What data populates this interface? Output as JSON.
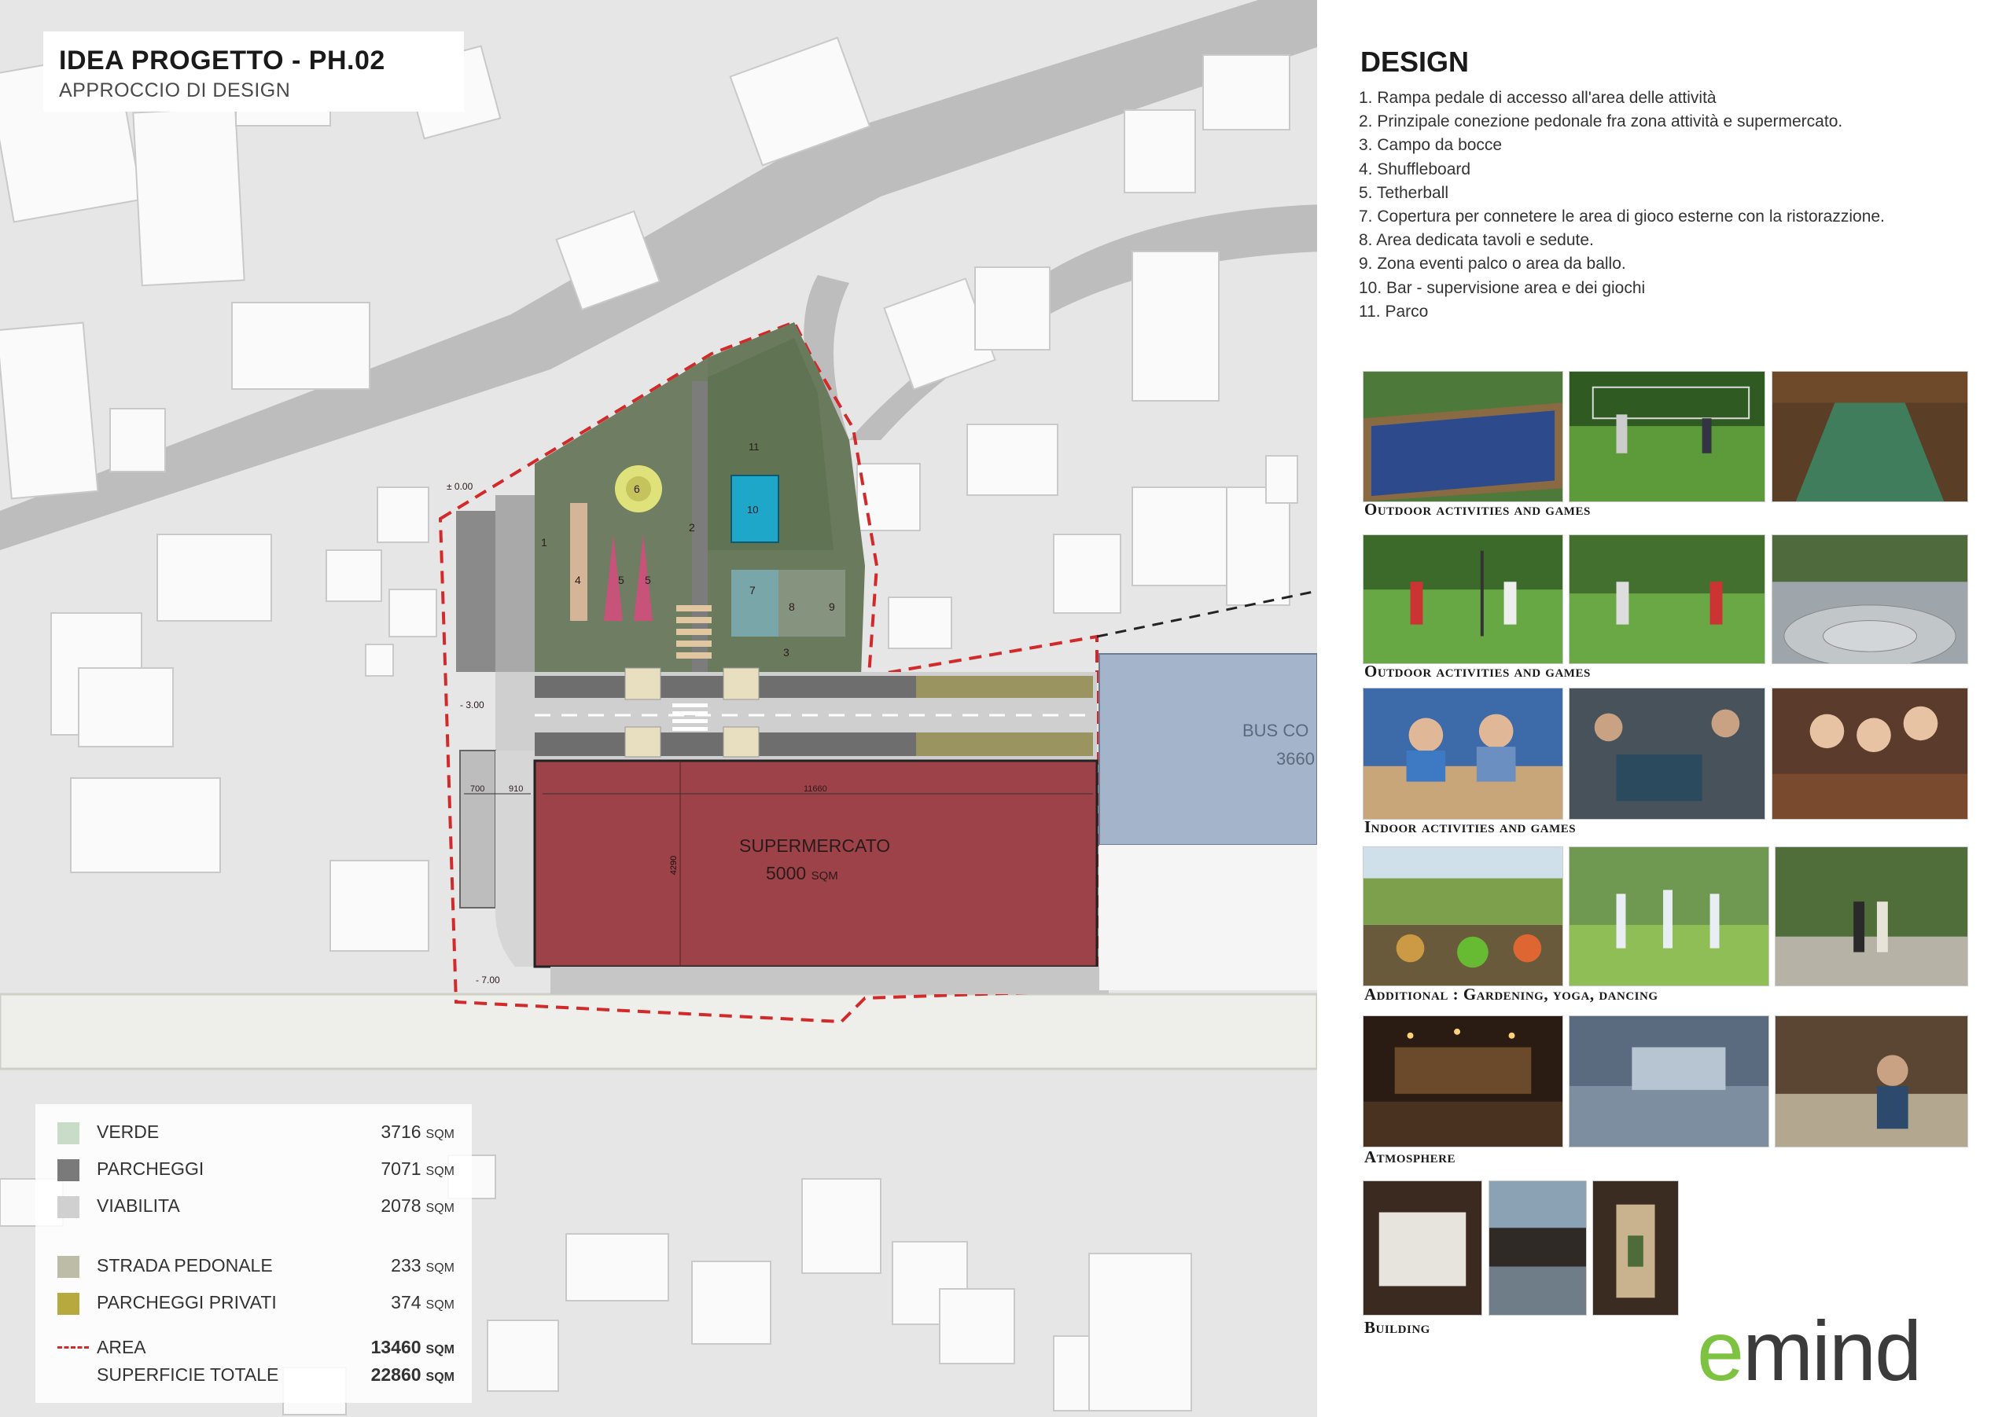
{
  "header": {
    "title": "IDEA PROGETTO - PH.02",
    "subtitle": "APPROCCIO DI DESIGN"
  },
  "plan": {
    "supermarket_label": "SUPERMERCATO",
    "supermarket_area": "5000",
    "supermarket_unit": "SQM",
    "bus_label": "BUS CO",
    "bus_value": "3660",
    "dim_11660": "11660",
    "dim_700": "700",
    "dim_910": "910",
    "dim_4290": "4290",
    "level_000": "± 0.00",
    "level_300": "- 3.00",
    "level_700": "- 7.00",
    "numbers": [
      "1",
      "2",
      "3",
      "4",
      "5",
      "5",
      "6",
      "7",
      "8",
      "9",
      "10",
      "11"
    ]
  },
  "legend": {
    "items": [
      {
        "label": "VERDE",
        "value": "3716",
        "unit": "SQM",
        "color": "#c9dcc7"
      },
      {
        "label": "PARCHEGGI",
        "value": "7071",
        "unit": "SQM",
        "color": "#7a7a7a"
      },
      {
        "label": "VIABILITA",
        "value": "2078",
        "unit": "SQM",
        "color": "#d0d0d0"
      },
      {
        "label": "STRADA PEDONALE",
        "value": "233",
        "unit": "SQM",
        "color": "#bdbca6"
      },
      {
        "label": "PARCHEGGI PRIVATI",
        "value": "374",
        "unit": "SQM",
        "color": "#b8a93f"
      },
      {
        "label": "AREA",
        "value": "13460",
        "unit": "SQM",
        "color": "#d22a2a"
      },
      {
        "label": "SUPERFICIE TOTALE",
        "value": "22860",
        "unit": "SQM"
      }
    ]
  },
  "panel": {
    "title": "DESIGN",
    "list": [
      "1. Rampa pedale di accesso all'area delle attività",
      "2. Prinzipale conezione pedonale fra zona attività e supermercato.",
      "3. Campo da bocce",
      "4. Shuffleboard",
      "5. Tetherball",
      "7. Copertura per connetere le area di gioco esterne con la ristorazzione.",
      "8. Area dedicata tavoli e sedute.",
      "9. Zona eventi palco o area da ballo.",
      "10. Bar - supervisione area e dei giochi",
      "11. Parco"
    ],
    "captions": [
      "Outdoor activities and games",
      "Outdoor activities and games",
      "Indoor activities and games",
      "Additional : Gardening, yoga, dancing",
      "Atmosphere",
      "Building"
    ],
    "logo_e": "e",
    "logo_rest": "mind"
  },
  "colors": {
    "supermarket": "#9c4248",
    "bus": "#a3b4cb",
    "area_border": "#d22a2a",
    "pool": "#1fa7c9",
    "green": "#6f7d62",
    "logo_green": "#7ec242"
  }
}
